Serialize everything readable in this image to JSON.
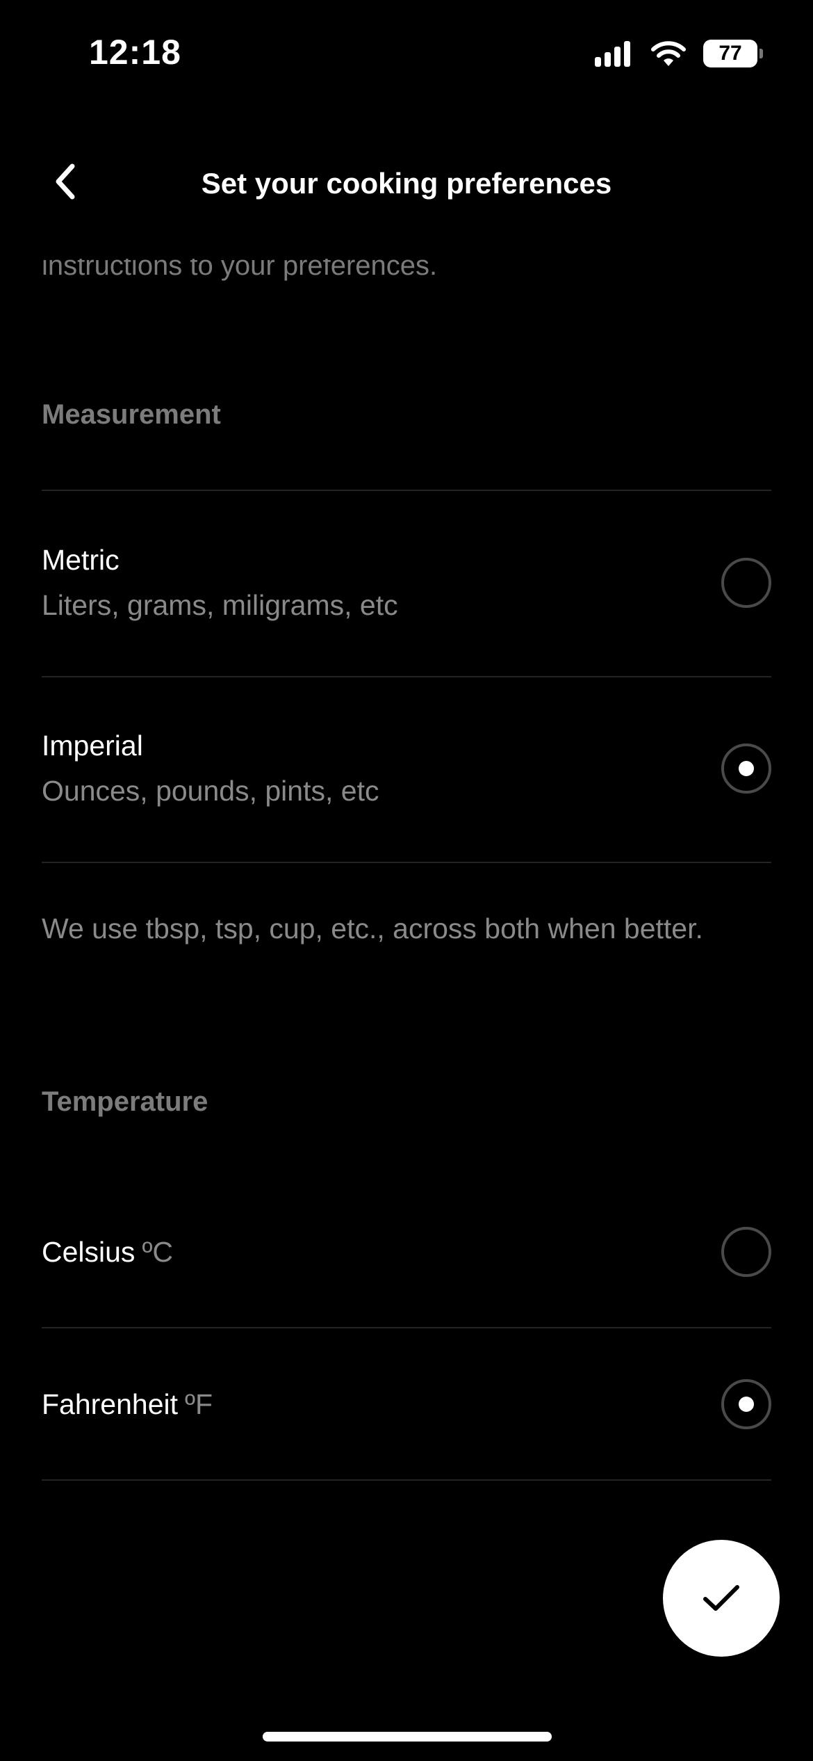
{
  "status_bar": {
    "time": "12:18",
    "battery": "77",
    "icons": [
      "cellular-signal-icon",
      "wifi-icon",
      "battery-icon"
    ]
  },
  "nav": {
    "back_icon": "chevron-left-icon",
    "title": "Set your cooking preferences"
  },
  "intro_text": "instructions to your preferences.",
  "measurement": {
    "heading": "Measurement",
    "options": [
      {
        "title": "Metric",
        "subtitle": "Liters, grams, miligrams, etc",
        "selected": false
      },
      {
        "title": "Imperial",
        "subtitle": "Ounces, pounds, pints, etc",
        "selected": true
      }
    ],
    "note": "We use tbsp, tsp, cup, etc., across both when better."
  },
  "temperature": {
    "heading": "Temperature",
    "options": [
      {
        "title": "Celsius",
        "unit": "ºC",
        "selected": false
      },
      {
        "title": "Fahrenheit",
        "unit": "ºF",
        "selected": true
      }
    ]
  },
  "confirm_button": {
    "icon": "checkmark-icon"
  },
  "colors": {
    "background": "#000000",
    "primary_text": "#ffffff",
    "secondary_text": "#8a8a8a",
    "divider": "#242424",
    "fab": "#ffffff"
  }
}
